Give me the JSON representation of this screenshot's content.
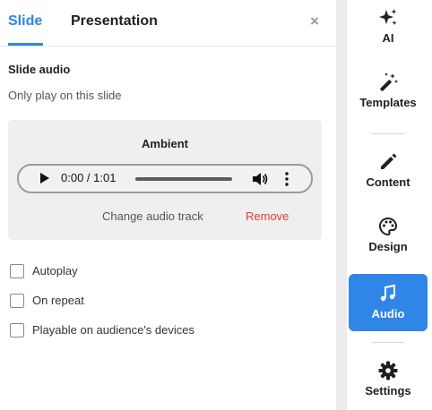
{
  "tabs": {
    "slide": "Slide",
    "presentation": "Presentation"
  },
  "close_glyph": "×",
  "slide_audio": {
    "title": "Slide audio",
    "subtitle": "Only play on this slide",
    "track_name": "Ambient",
    "player": {
      "time": "0:00 / 1:01"
    },
    "change_label": "Change audio track",
    "remove_label": "Remove"
  },
  "options": [
    {
      "label": "Autoplay",
      "checked": false
    },
    {
      "label": "On repeat",
      "checked": false
    },
    {
      "label": "Playable on audience's devices",
      "checked": false
    }
  ],
  "rail": {
    "items": [
      {
        "label": "AI",
        "icon": "sparkles-icon"
      },
      {
        "label": "Templates",
        "icon": "magic-wand-icon"
      },
      {
        "label": "Content",
        "icon": "pencil-icon"
      },
      {
        "label": "Design",
        "icon": "palette-icon"
      },
      {
        "label": "Audio",
        "icon": "music-note-icon",
        "active": true
      },
      {
        "label": "Settings",
        "icon": "gear-icon"
      }
    ]
  },
  "colors": {
    "accent": "#2f86e6",
    "danger": "#e53935",
    "panel_bg": "#efefef"
  }
}
